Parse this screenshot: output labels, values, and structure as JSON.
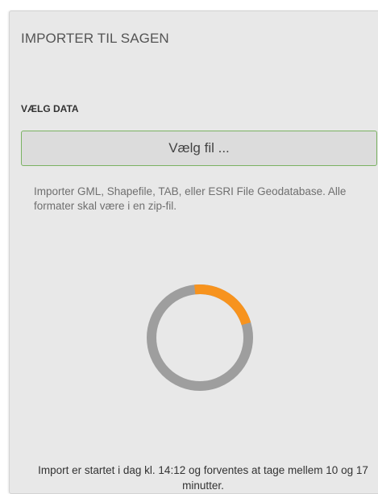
{
  "panel": {
    "title": "IMPORTER TIL SAGEN",
    "section_label": "VÆLG DATA",
    "file_button_label": "Vælg fil ...",
    "help_text": "Importer GML, Shapefile, TAB, eller ESRI File Geodatabase. Alle formater skal være i en zip-fil.",
    "status_text": "Import er startet i dag kl. 14:12 og forventes at tage mellem 10 og 17 minutter."
  },
  "spinner": {
    "progress_fraction": 0.22,
    "track_color": "#9e9e9e",
    "progress_color": "#f7931e"
  },
  "colors": {
    "panel_background": "#e8e8e8",
    "button_border": "#7ab262"
  }
}
